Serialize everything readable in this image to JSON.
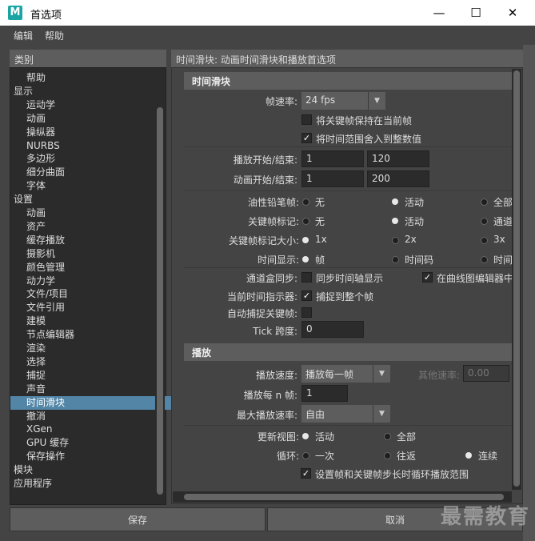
{
  "window": {
    "title": "首选项",
    "icon_letter": "M",
    "controls": {
      "minimize": "—",
      "maximize": "☐",
      "close": "✕"
    }
  },
  "menubar": [
    "编辑",
    "帮助"
  ],
  "categories": {
    "header": "类别",
    "items": [
      {
        "label": "帮助",
        "level": 1
      },
      {
        "label": "显示",
        "level": 0
      },
      {
        "label": "运动学",
        "level": 1
      },
      {
        "label": "动画",
        "level": 1
      },
      {
        "label": "操纵器",
        "level": 1
      },
      {
        "label": "NURBS",
        "level": 1
      },
      {
        "label": "多边形",
        "level": 1
      },
      {
        "label": "细分曲面",
        "level": 1
      },
      {
        "label": "字体",
        "level": 1
      },
      {
        "label": "设置",
        "level": 0
      },
      {
        "label": "动画",
        "level": 1
      },
      {
        "label": "资产",
        "level": 1
      },
      {
        "label": "缓存播放",
        "level": 1
      },
      {
        "label": "摄影机",
        "level": 1
      },
      {
        "label": "颜色管理",
        "level": 1
      },
      {
        "label": "动力学",
        "level": 1
      },
      {
        "label": "文件/项目",
        "level": 1
      },
      {
        "label": "文件引用",
        "level": 1
      },
      {
        "label": "建模",
        "level": 1
      },
      {
        "label": "节点编辑器",
        "level": 1
      },
      {
        "label": "渲染",
        "level": 1
      },
      {
        "label": "选择",
        "level": 1
      },
      {
        "label": "捕捉",
        "level": 1
      },
      {
        "label": "声音",
        "level": 1
      },
      {
        "label": "时间滑块",
        "level": 1,
        "selected": true
      },
      {
        "label": "撤消",
        "level": 1
      },
      {
        "label": "XGen",
        "level": 1
      },
      {
        "label": "GPU 缓存",
        "level": 1
      },
      {
        "label": "保存操作",
        "level": 1
      },
      {
        "label": "模块",
        "level": 0
      },
      {
        "label": "应用程序",
        "level": 0
      }
    ]
  },
  "panel": {
    "header": "时间滑块: 动画时间滑块和播放首选项",
    "timeslider": {
      "section_title": "时间滑块",
      "framerate_label": "帧速率:",
      "framerate_value": "24 fps",
      "keep_keys_label": "将关键帧保持在当前帧",
      "keep_keys_checked": false,
      "snap_range_label": "将时间范围舍入到整数值",
      "snap_range_checked": true,
      "playback_range_label": "播放开始/结束:",
      "playback_start": "1",
      "playback_end": "120",
      "anim_range_label": "动画开始/结束:",
      "anim_start": "1",
      "anim_end": "200",
      "grease_label": "油性铅笔帧:",
      "grease_options": [
        "无",
        "活动",
        "全部"
      ],
      "grease_selected": 1,
      "keyticks_label": "关键帧标记:",
      "keyticks_options": [
        "无",
        "活动",
        "通道"
      ],
      "keyticks_selected": 1,
      "ticksize_label": "关键帧标记大小:",
      "ticksize_options": [
        "1x",
        "2x",
        "3x"
      ],
      "ticksize_selected": 0,
      "timedisplay_label": "时间显示:",
      "timedisplay_options": [
        "帧",
        "时间码",
        "时间"
      ],
      "timedisplay_selected": 0,
      "channelbox_label": "通道盒同步:",
      "sync_time_label": "同步时间轴显示",
      "sync_time_checked": false,
      "graph_editor_label": "在曲线图编辑器中",
      "graph_editor_checked": true,
      "indicator_label": "当前时间指示器:",
      "snap_whole_label": "捕捉到整个帧",
      "snap_whole_checked": true,
      "autosnap_label": "自动捕捉关键帧:",
      "autosnap_checked": false,
      "tick_span_label": "Tick 跨度:",
      "tick_span_value": "0"
    },
    "playback": {
      "section_title": "播放",
      "speed_label": "播放速度:",
      "speed_value": "播放每一帧",
      "other_speed_label": "其他速率:",
      "other_speed_value": "0.00",
      "every_n_label": "播放每 n 帧:",
      "every_n_value": "1",
      "max_speed_label": "最大播放速率:",
      "max_speed_value": "自由",
      "update_view_label": "更新视图:",
      "update_view_options": [
        "活动",
        "全部"
      ],
      "update_view_selected": 0,
      "loop_label": "循环:",
      "loop_options": [
        "一次",
        "往返",
        "连续"
      ],
      "loop_selected": 2,
      "loop_keys_label": "设置帧和关键帧步长时循环播放范围",
      "loop_keys_checked": true
    }
  },
  "buttons": {
    "save": "保存",
    "cancel": "取消"
  },
  "watermark": "最需教育",
  "colors": {
    "selection": "#5285a6",
    "panel_bg": "#444444",
    "field_bg": "#2b2b2b",
    "header_bg": "#5d5d5d"
  }
}
